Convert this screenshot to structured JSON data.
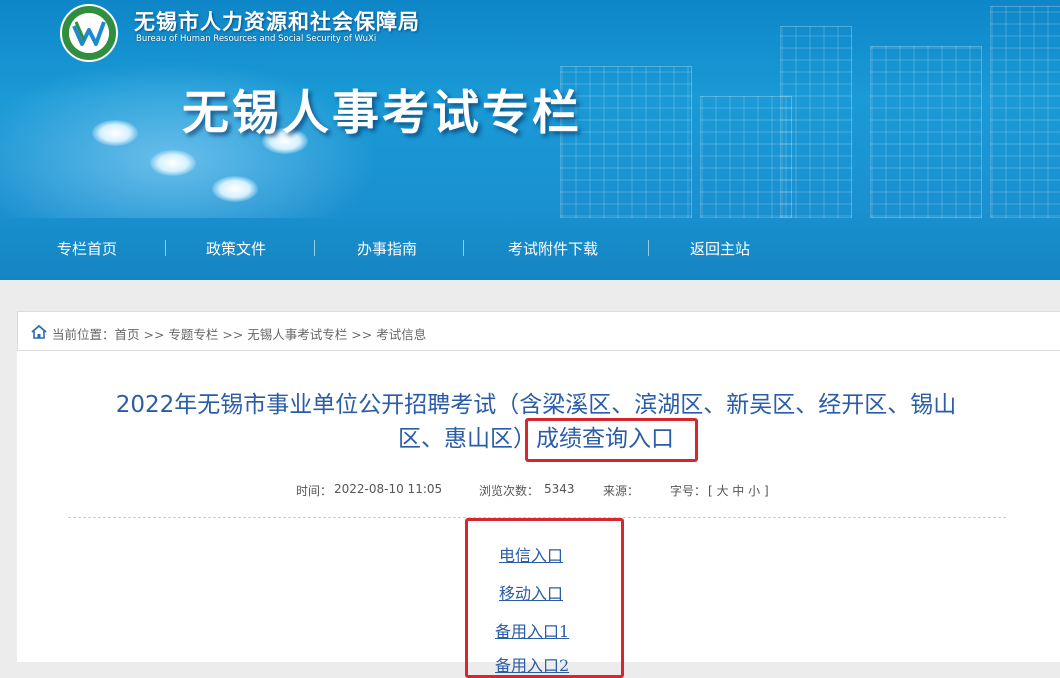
{
  "colors": {
    "banner_blue": "#1a9ad6",
    "nav_blue": "#1584c2",
    "title_blue": "#2a5ca8",
    "highlight_red": "#d8252e"
  },
  "header": {
    "org_name_cn": "无锡市人力资源和社会保障局",
    "org_name_en": "Bureau of Human Resources and Social Security of WuXi",
    "site_title": "无锡人事考试专栏"
  },
  "nav": {
    "items": [
      "专栏首页",
      "政策文件",
      "办事指南",
      "考试附件下载",
      "返回主站"
    ]
  },
  "breadcrumb": {
    "prefix": "当前位置：",
    "text": "首页 >> 专题专栏 >> 无锡人事考试专栏 >> 考试信息"
  },
  "article": {
    "title_line1": "2022年无锡市事业单位公开招聘考试（含梁溪区、滨湖区、新吴区、经开区、锡山",
    "title_line2_prefix": "区、惠山区）",
    "title_line2_highlight": "成绩查询入口",
    "meta": {
      "time_label": "时间：",
      "time_value": "2022-08-10 11:05",
      "views_label": "浏览次数：",
      "views_value": "5343",
      "source_label": "来源：",
      "font_label": "字号：",
      "font_sizes": "[ 大 中 小 ]"
    },
    "links": [
      "电信入口",
      "移动入口",
      "备用入口1",
      "备用入口2"
    ]
  }
}
